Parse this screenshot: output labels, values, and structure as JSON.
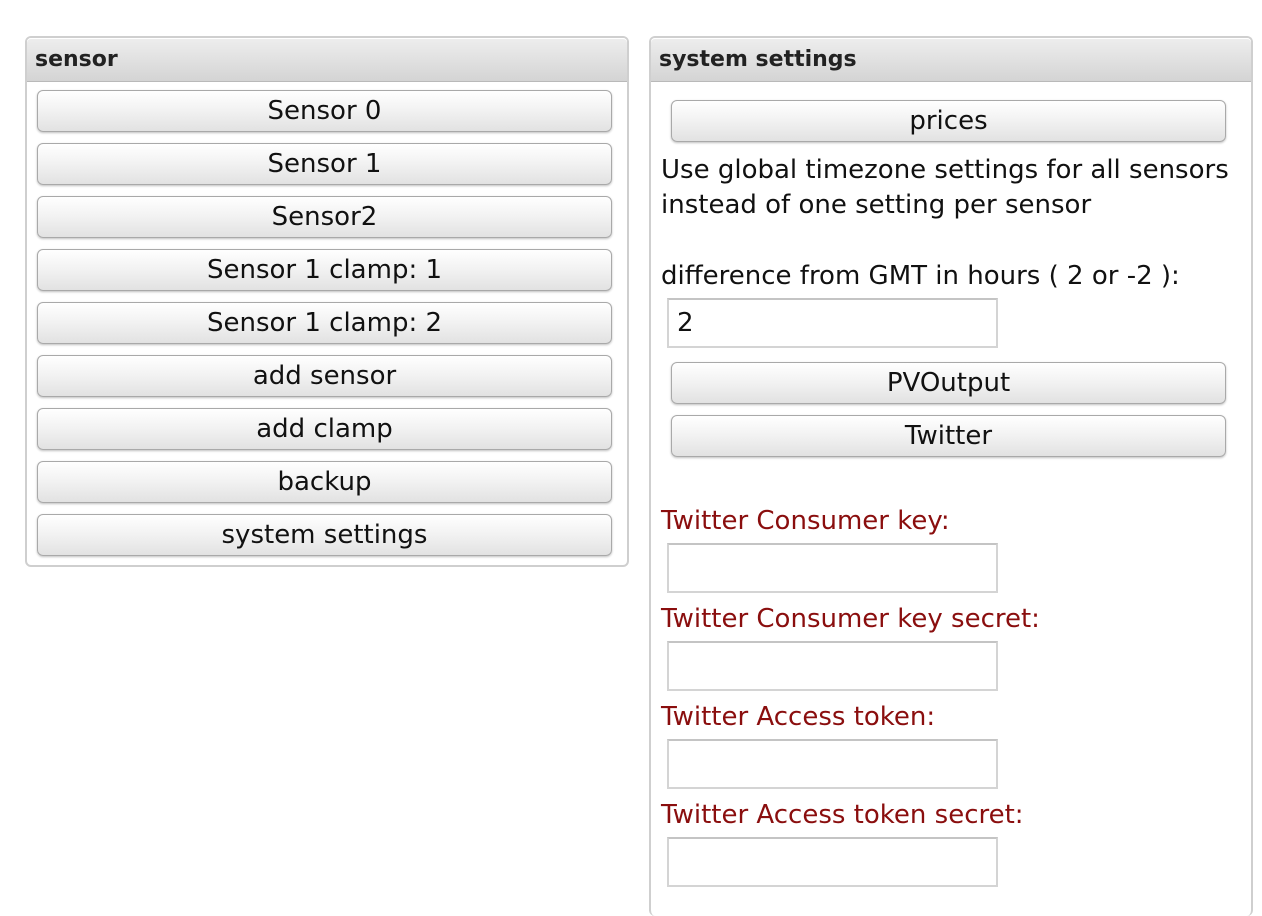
{
  "sensor_panel": {
    "title": "sensor",
    "buttons": [
      "Sensor 0",
      "Sensor 1",
      "Sensor2",
      "Sensor 1 clamp: 1",
      "Sensor 1 clamp: 2",
      "add sensor",
      "add clamp",
      "backup",
      "system settings"
    ]
  },
  "settings_panel": {
    "title": "system settings",
    "prices_button": "prices",
    "timezone_text": "Use global timezone settings for all sensors instead of one setting per sensor",
    "gmt_label": "difference from GMT in hours ( 2 or -2 ):",
    "gmt_value": "2",
    "pvoutput_button": "PVOutput",
    "twitter_button": "Twitter",
    "twitter_fields": {
      "consumer_key_label": "Twitter Consumer key:",
      "consumer_key_value": "",
      "consumer_secret_label": "Twitter Consumer key secret:",
      "consumer_secret_value": "",
      "access_token_label": "Twitter Access token:",
      "access_token_value": "",
      "access_secret_label": "Twitter Access token secret:",
      "access_secret_value": ""
    },
    "label_color": "#8a0e0e"
  }
}
